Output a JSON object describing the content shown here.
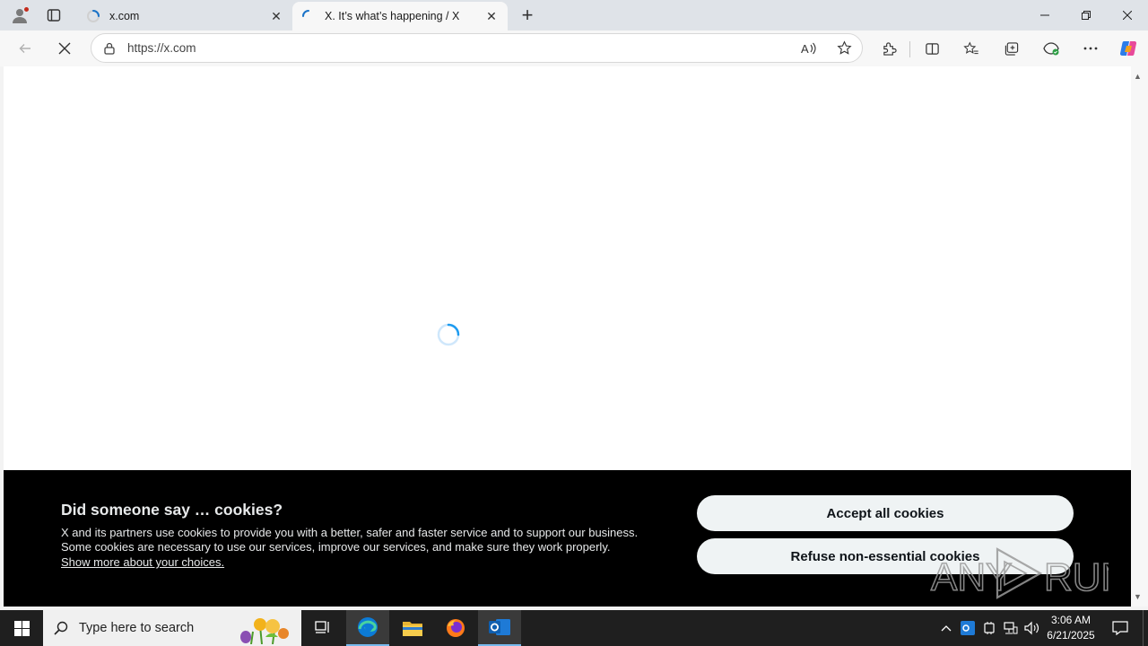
{
  "browser": {
    "tabs": [
      {
        "title": "x.com",
        "active": false
      },
      {
        "title": "X. It’s what’s happening / X",
        "active": true
      }
    ],
    "new_tab_label": "+",
    "window_controls": {
      "minimize": "—",
      "restore": "❐",
      "close": "✕"
    },
    "address_bar": {
      "url": "https://x.com"
    },
    "icons": [
      "profile-icon",
      "tab-actions-icon",
      "back-icon",
      "stop-icon",
      "site-info-icon",
      "read-aloud-icon",
      "favorite-icon",
      "extensions-icon",
      "split-screen-icon",
      "favorites-icon",
      "collections-icon",
      "browser-essentials-icon",
      "more-icon",
      "copilot-icon"
    ]
  },
  "page": {
    "state": "loading",
    "cookie_banner": {
      "title": "Did someone say … cookies?",
      "description": "X and its partners use cookies to provide you with a better, safer and faster service and to support our business. Some cookies are necessary to use our services, improve our services, and make sure they work properly.",
      "link": "Show more about your choices.",
      "accept_button": "Accept all cookies",
      "refuse_button": "Refuse non-essential cookies"
    }
  },
  "watermark": "ANY RUN",
  "taskbar": {
    "search_placeholder": "Type here to search",
    "apps": [
      "task-view",
      "edge",
      "file-explorer",
      "firefox",
      "outlook"
    ],
    "clock": {
      "time": "3:06 AM",
      "date": "6/21/2025"
    }
  },
  "colors": {
    "banner_bg": "#000000",
    "button_bg": "#eff3f4",
    "loader": "#1d9bf0",
    "taskbar": "#1f1f1f"
  }
}
